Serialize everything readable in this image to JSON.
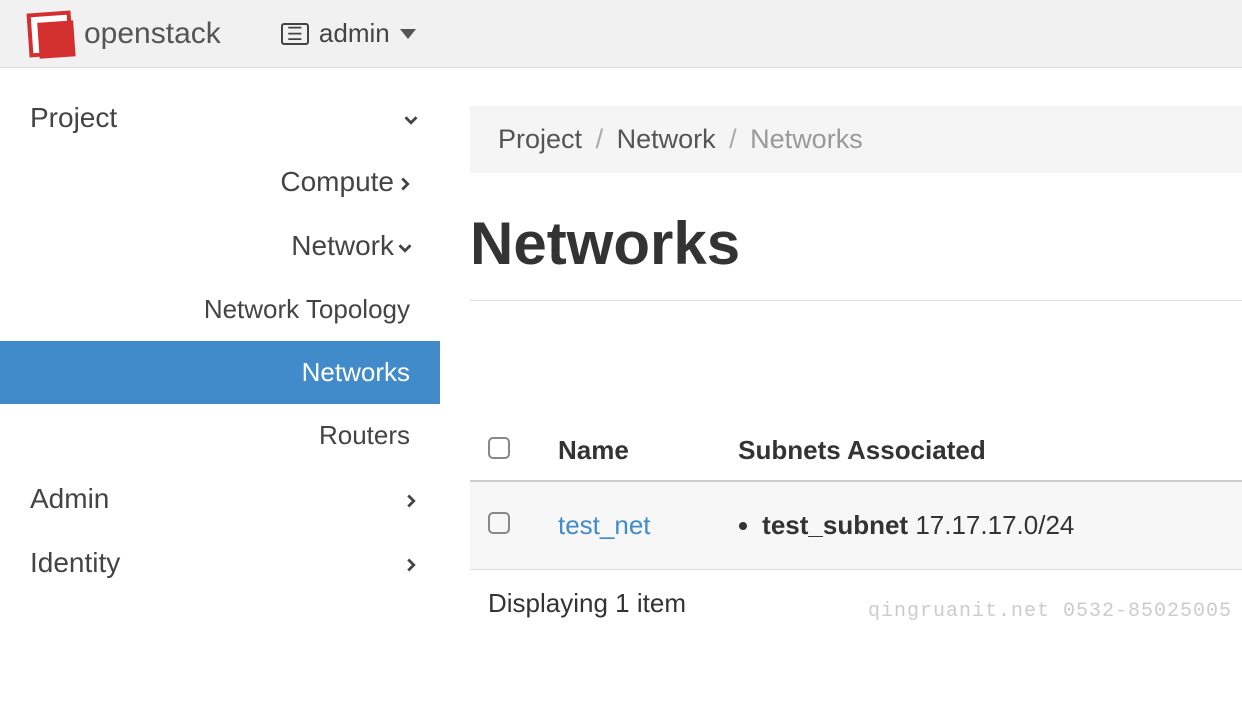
{
  "header": {
    "brand": "openstack",
    "project_selector": "admin"
  },
  "sidebar": {
    "items": [
      {
        "label": "Project",
        "level": 1,
        "expanded": true
      },
      {
        "label": "Compute",
        "level": 2,
        "expanded": false
      },
      {
        "label": "Network",
        "level": 2,
        "expanded": true
      },
      {
        "label": "Network Topology",
        "level": 3,
        "active": false
      },
      {
        "label": "Networks",
        "level": 3,
        "active": true
      },
      {
        "label": "Routers",
        "level": 3,
        "active": false
      },
      {
        "label": "Admin",
        "level": 1,
        "expanded": false
      },
      {
        "label": "Identity",
        "level": 1,
        "expanded": false
      }
    ]
  },
  "breadcrumb": {
    "items": [
      "Project",
      "Network",
      "Networks"
    ]
  },
  "page": {
    "title": "Networks"
  },
  "table": {
    "columns": [
      "Name",
      "Subnets Associated"
    ],
    "rows": [
      {
        "name": "test_net",
        "subnets": [
          {
            "name": "test_subnet",
            "cidr": "17.17.17.0/24"
          }
        ]
      }
    ],
    "footer": "Displaying 1 item"
  },
  "watermark": "qingruanit.net 0532-85025005"
}
